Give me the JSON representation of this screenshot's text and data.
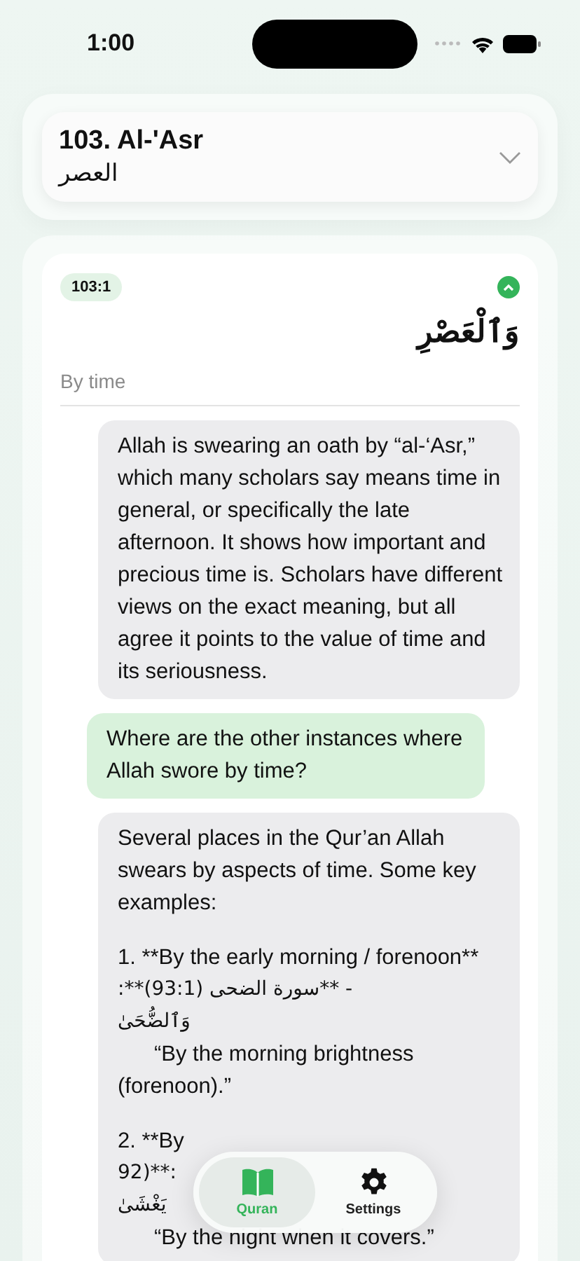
{
  "status_bar": {
    "time": "1:00"
  },
  "surah_picker": {
    "title": "103. Al-'Asr",
    "arabic_name": "العصر",
    "expanded": false
  },
  "verse": {
    "reference": "103:1",
    "expanded": true,
    "arabic": "وَٱلْعَصْرِ",
    "translation": "By time"
  },
  "messages": [
    {
      "kind": "assistant",
      "paragraphs": [
        [
          {
            "kind": "text",
            "text": "Allah is swearing an oath by “al-‘Asr,” which many scholars say means time in general, or specifically the late afternoon. It shows how important and precious time is. Scholars have different views on the exact meaning, but all agree it points to the value of time and its seriousness."
          }
        ]
      ]
    },
    {
      "kind": "user",
      "paragraphs": [
        [
          {
            "kind": "text",
            "text": "Where are the other instances where Allah swore by time?"
          }
        ]
      ]
    },
    {
      "kind": "assistant",
      "paragraphs": [
        [
          {
            "kind": "text",
            "text": "Several places in the Qur’an Allah swears by aspects of time. Some key examples:"
          }
        ],
        [
          {
            "kind": "text",
            "text": "1. **By the early morning / forenoon**"
          },
          {
            "kind": "rtl",
            "text": "- **سورة الضحى (93:1)**:"
          },
          {
            "kind": "arabic",
            "text": "وَٱلضُّحَىٰ"
          },
          {
            "kind": "quote",
            "text": "“By the morning brightness (forenoon).”"
          }
        ],
        [
          {
            "kind": "text",
            "text": "2. **By"
          },
          {
            "kind": "rtl",
            "text": ":**(92"
          },
          {
            "kind": "arabic",
            "text": "يَغْشَىٰ"
          },
          {
            "kind": "quote",
            "text": "“By the night when it covers.”"
          }
        ]
      ]
    }
  ],
  "tab_bar": [
    {
      "label": "Quran",
      "selected": true
    },
    {
      "label": "Settings",
      "selected": false
    }
  ]
}
